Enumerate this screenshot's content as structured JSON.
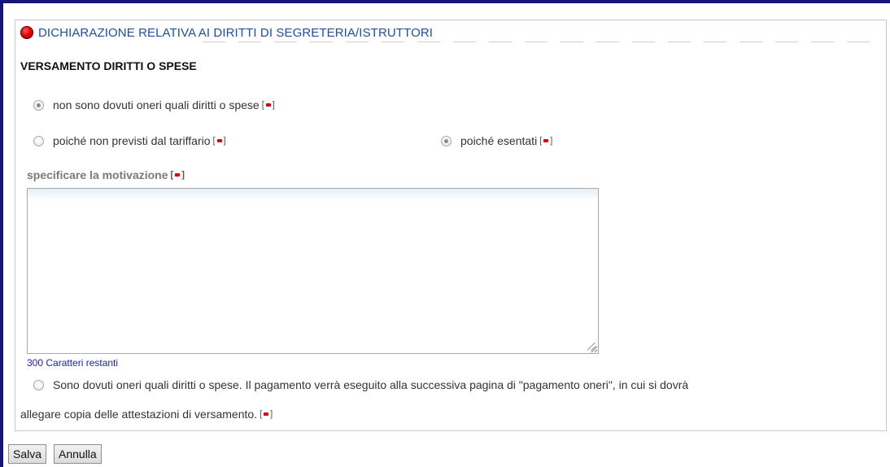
{
  "panel": {
    "title": "DICHIARAZIONE RELATIVA AI DIRITTI DI SEGRETERIA/ISTRUTTORI",
    "bullet_color": "#e00000",
    "title_color": "#1f4ea3"
  },
  "section": {
    "title": "VERSAMENTO DIRITTI O SPESE"
  },
  "required_marker": "[▪]",
  "options": {
    "no_fees": {
      "label": "non sono dovuti oneri quali diritti o spese",
      "checked": true
    },
    "not_in_tariff": {
      "label": "poiché non previsti dal tariffario",
      "checked": false
    },
    "exempt": {
      "label": "poiché esentati",
      "checked": true
    },
    "fees_due": {
      "label_line1": "Sono dovuti oneri quali diritti o spese. Il pagamento verrà eseguito alla successiva pagina di \"pagamento oneri\", in cui si dovrà",
      "label_line2": "allegare copia delle attestazioni di versamento.",
      "checked": false
    }
  },
  "motivation": {
    "label": "specificare la motivazione",
    "value": "",
    "remaining_text": "300 Caratteri restanti"
  },
  "buttons": {
    "save": "Salva",
    "cancel": "Annulla"
  },
  "colors": {
    "frame": "#15157a",
    "counter": "#1a1ad0",
    "required_dot": "#e00000"
  }
}
